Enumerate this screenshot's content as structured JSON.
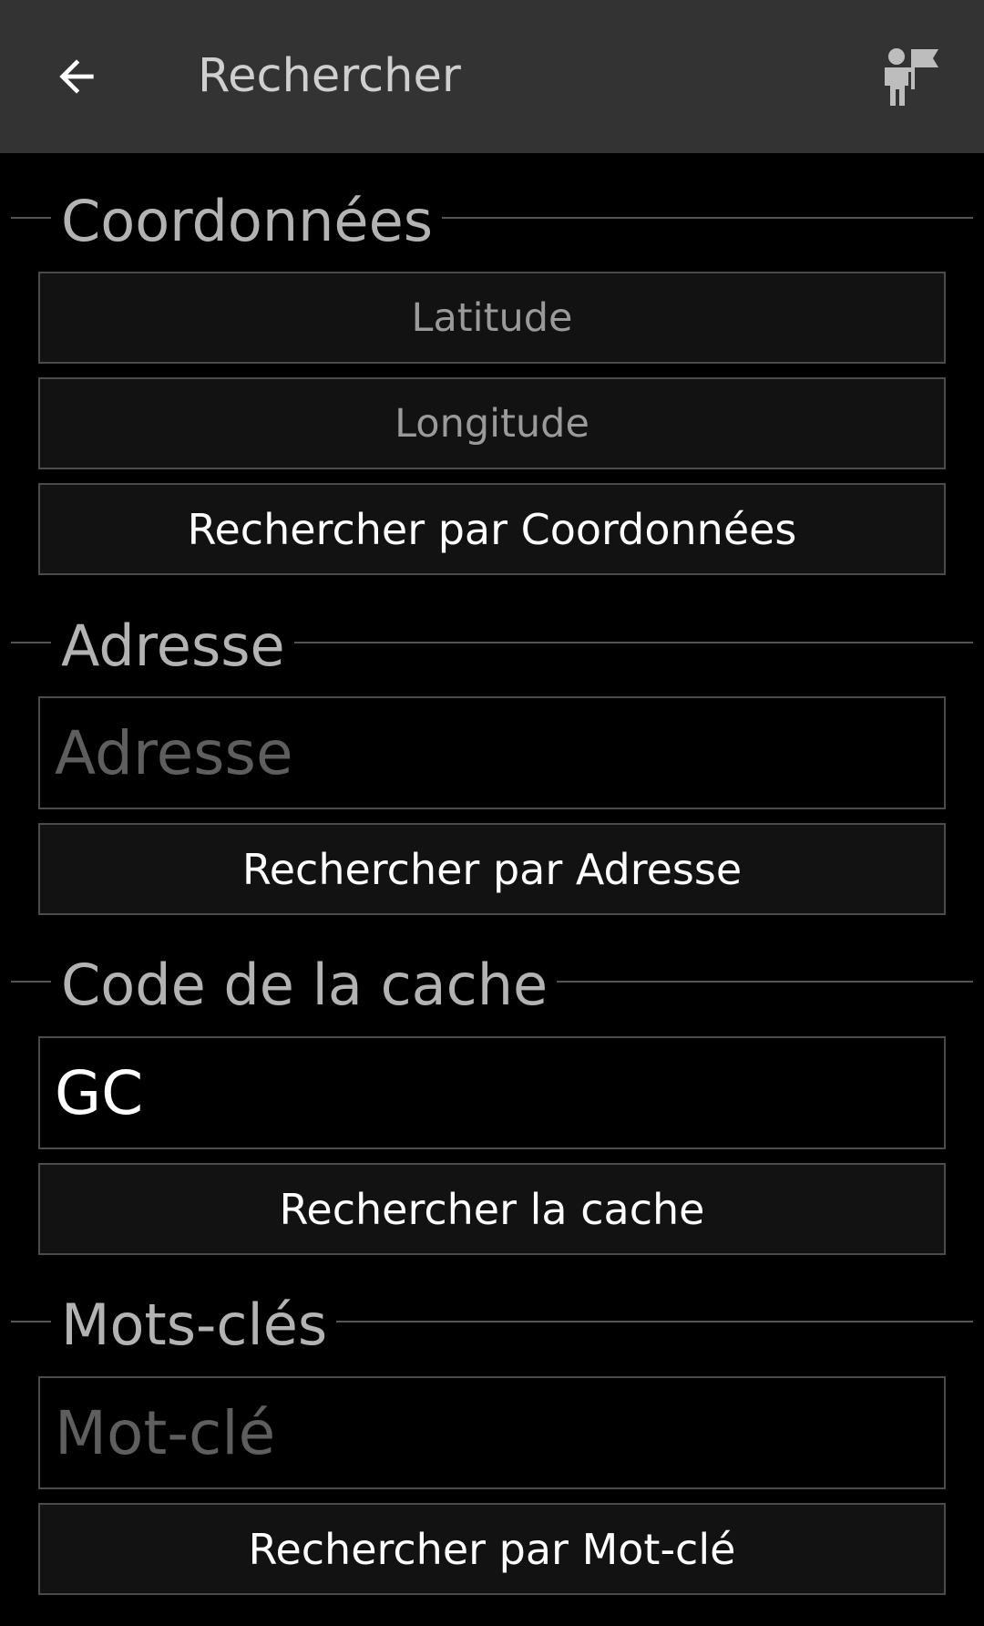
{
  "appbar": {
    "title": "Rechercher",
    "back_icon": "arrow-left-icon",
    "action_icon": "guide-person-flag-icon",
    "background": "#333333"
  },
  "sections": {
    "coordinates": {
      "heading": "Coordonnées",
      "latitude_placeholder": "Latitude",
      "longitude_placeholder": "Longitude",
      "button_label": "Rechercher par Coordonnées"
    },
    "address": {
      "heading": "Adresse",
      "input_placeholder": "Adresse",
      "button_label": "Rechercher par Adresse"
    },
    "cache_code": {
      "heading": "Code de la cache",
      "input_value": "GC",
      "button_label": "Rechercher la cache"
    },
    "keywords": {
      "heading": "Mots-clés",
      "input_placeholder": "Mot-clé",
      "button_label": "Rechercher par Mot-clé"
    }
  },
  "colors": {
    "background": "#000000",
    "field_border": "#4b4b4b",
    "heading_text": "#b3b3b3",
    "placeholder_text": "#5e5e5e"
  }
}
